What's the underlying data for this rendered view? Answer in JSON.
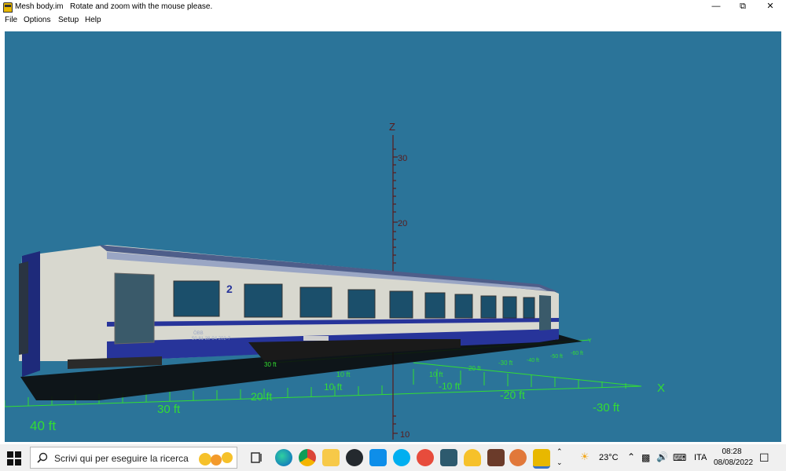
{
  "window": {
    "title": "Mesh body.im",
    "subtitle": "Rotate and zoom with the mouse please.",
    "minimize_icon": "minimize-icon",
    "restore_icon": "restore-icon",
    "close_icon": "close-icon"
  },
  "menu": [
    "File",
    "Options",
    "Setup",
    "Help"
  ],
  "viewport": {
    "background": "#2b7499",
    "axis_z_label": "Z",
    "axis_x_label": "X",
    "axis_y_label": "Y",
    "z_ticks": [
      "30",
      "20",
      "10"
    ],
    "x_labels_left": [
      "40 ft",
      "30 ft",
      "20 ft",
      "10 ft"
    ],
    "x_labels_right": [
      "-10 ft",
      "-20 ft",
      "-30 ft"
    ],
    "y_labels_far": [
      "30 ft",
      "10 ft",
      "10 ft",
      "20 ft",
      "-30 ft",
      "-40 ft",
      "-50 ft",
      "-60 ft"
    ],
    "coach_number": "2",
    "coach_markings": [
      "ÖBB",
      "50 81 28-04 202-7"
    ],
    "axis_color": "#5a1a1a",
    "grid_color": "#33dd33",
    "coach_colors": {
      "body": "#d8d8cf",
      "stripe": "#27349a",
      "window": "#1b4f6b"
    }
  },
  "taskbar": {
    "search_placeholder": "Scrivi qui per eseguire la ricerca",
    "pinned": [
      "task-view-icon",
      "edge-icon",
      "chrome-icon",
      "file-explorer-icon",
      "github-icon",
      "teamviewer-icon",
      "skype-icon",
      "app-icon-1",
      "app-icon-2",
      "app-icon-3",
      "app-icon-4",
      "app-icon-5",
      "mesh-app-icon"
    ],
    "temperature": "23°C",
    "language": "ITA",
    "time": "08:28",
    "date": "08/08/2022"
  }
}
